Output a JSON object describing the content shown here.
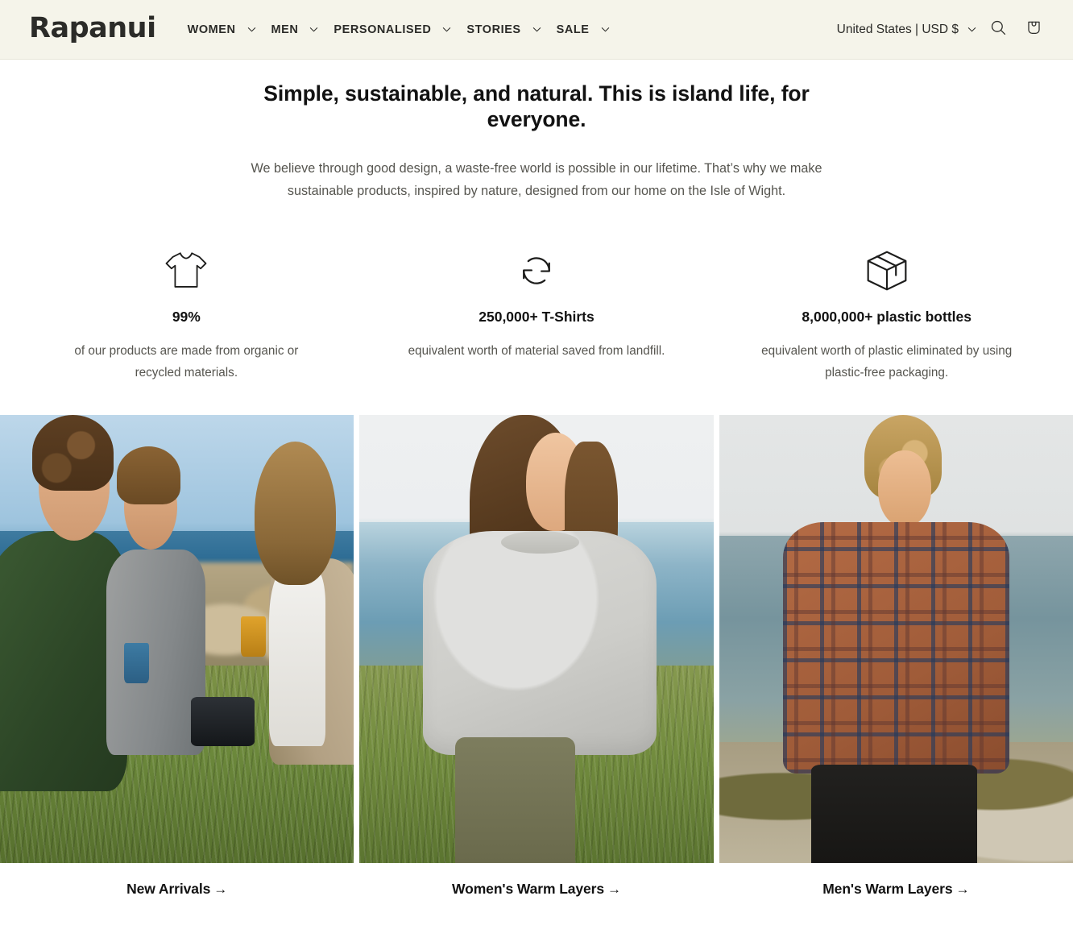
{
  "header": {
    "logo": "Rapanui",
    "nav": [
      {
        "label": "WOMEN",
        "has_dropdown": true
      },
      {
        "label": "MEN",
        "has_dropdown": true
      },
      {
        "label": "PERSONALISED",
        "has_dropdown": true
      },
      {
        "label": "STORIES",
        "has_dropdown": true
      },
      {
        "label": "SALE",
        "has_dropdown": true
      }
    ],
    "locale_selector": "United States | USD $",
    "search_icon": "search-icon",
    "cart_icon": "shopping-bag-icon",
    "background_color": "#F5F4EA"
  },
  "hero": {
    "title": "Simple, sustainable, and natural. This is island life, for everyone.",
    "subtitle": "We believe through good design, a waste-free world is possible in our lifetime. That’s why we make sustainable products, inspired by nature, designed from our home on the Isle of Wight."
  },
  "stats": [
    {
      "icon": "t-shirt-icon",
      "value": "99%",
      "description": "of our products are made from organic or recycled materials."
    },
    {
      "icon": "recycle-arrows-icon",
      "value": "250,000+ T-Shirts",
      "description": "equivalent worth of material saved from landfill."
    },
    {
      "icon": "package-box-icon",
      "value": "8,000,000+ plastic bottles",
      "description": "equivalent worth of plastic eliminated by using plastic-free packaging."
    }
  ],
  "tiles": [
    {
      "caption": "New Arrivals",
      "arrow": "→",
      "image_alt": "Three people sitting on coastal grass with enamel mugs and a camera, sea behind them"
    },
    {
      "caption": "Women's Warm Layers",
      "arrow": "→",
      "image_alt": "Woman in a grey knitted jumper and olive trousers walking on a clifftop by the sea"
    },
    {
      "caption": "Men's Warm Layers",
      "arrow": "→",
      "image_alt": "Smiling man in a rust and navy check flannel shirt standing on a pebble beach"
    }
  ],
  "colors": {
    "header_bg": "#F5F4EA",
    "page_bg": "#FFFFFF",
    "text_primary": "#121212",
    "text_muted": "#56554F"
  }
}
